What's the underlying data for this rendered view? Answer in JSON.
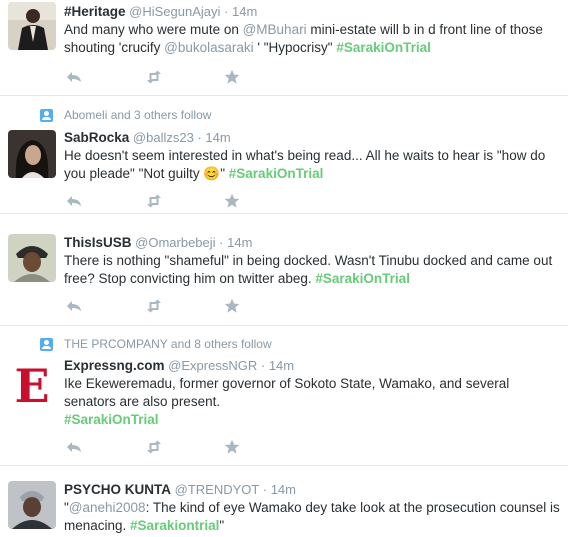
{
  "tweets": [
    {
      "context": "",
      "fullname": "#Heritage",
      "handle": "@HiSegunAjayi",
      "separator": "·",
      "time": "14m",
      "parts": [
        {
          "t": "text",
          "v": "And many who were mute on "
        },
        {
          "t": "mention",
          "v": "@MBuhari"
        },
        {
          "t": "text",
          "v": " mini-estate will b in d front line of those shouting 'crucify "
        },
        {
          "t": "mention",
          "v": "@bukolasaraki"
        },
        {
          "t": "text",
          "v": " ' \"Hypocrisy\" "
        },
        {
          "t": "hashtag",
          "v": "#SarakiOnTrial"
        }
      ]
    },
    {
      "context": "Abomeli and 3 others follow",
      "fullname": "SabRocka",
      "handle": "@ballzs23",
      "separator": "·",
      "time": "14m",
      "parts": [
        {
          "t": "text",
          "v": "He doesn't seem interested in what's being read... All he waits to hear is \"how do you pleade\" \"Not guilty 😊\" "
        },
        {
          "t": "hashtag",
          "v": "#SarakiOnTrial"
        }
      ]
    },
    {
      "context": "",
      "fullname": "ThisIsUSB",
      "handle": "@Omarbebeji",
      "separator": "·",
      "time": "14m",
      "parts": [
        {
          "t": "text",
          "v": "There is nothing \"shameful\" in being docked. Wasn't Tinubu docked and came out free? Stop convicting him on twitter abeg. "
        },
        {
          "t": "hashtag",
          "v": "#SarakiOnTrial"
        }
      ]
    },
    {
      "context": "THE PRCOMPANY and 8 others follow",
      "fullname": "Expressng.com",
      "handle": "@ExpressNGR",
      "separator": "·",
      "time": "14m",
      "avatar_letter": "E",
      "parts": [
        {
          "t": "text",
          "v": "Ike Ekeweremadu, former governor of Sokoto State, Wamako, and several senators are also present."
        },
        {
          "t": "br",
          "v": ""
        },
        {
          "t": "hashtag",
          "v": "#SarakiOnTrial"
        }
      ]
    },
    {
      "context": "",
      "fullname": "PSYCHO KUNTA",
      "handle": "@TRENDYOT",
      "separator": "·",
      "time": "14m",
      "parts": [
        {
          "t": "text",
          "v": "\""
        },
        {
          "t": "mention",
          "v": "@anehi2008"
        },
        {
          "t": "text",
          "v": ": The kind of eye Wamako dey take look at the prosecution counsel is menacing. "
        },
        {
          "t": "hashtag",
          "v": "#Sarakiontrial"
        },
        {
          "t": "text",
          "v": "\""
        }
      ]
    }
  ],
  "icons": {
    "reply": "reply-icon",
    "retweet": "retweet-icon",
    "favorite": "star-icon",
    "social_context": "follow-person-icon"
  },
  "colors": {
    "hashtag": "#66cc77",
    "mention": "#8899a6",
    "meta": "#8899a6",
    "divider": "#e1e8ed",
    "action_icon": "#aab8c2",
    "context_icon": "#55acee"
  }
}
